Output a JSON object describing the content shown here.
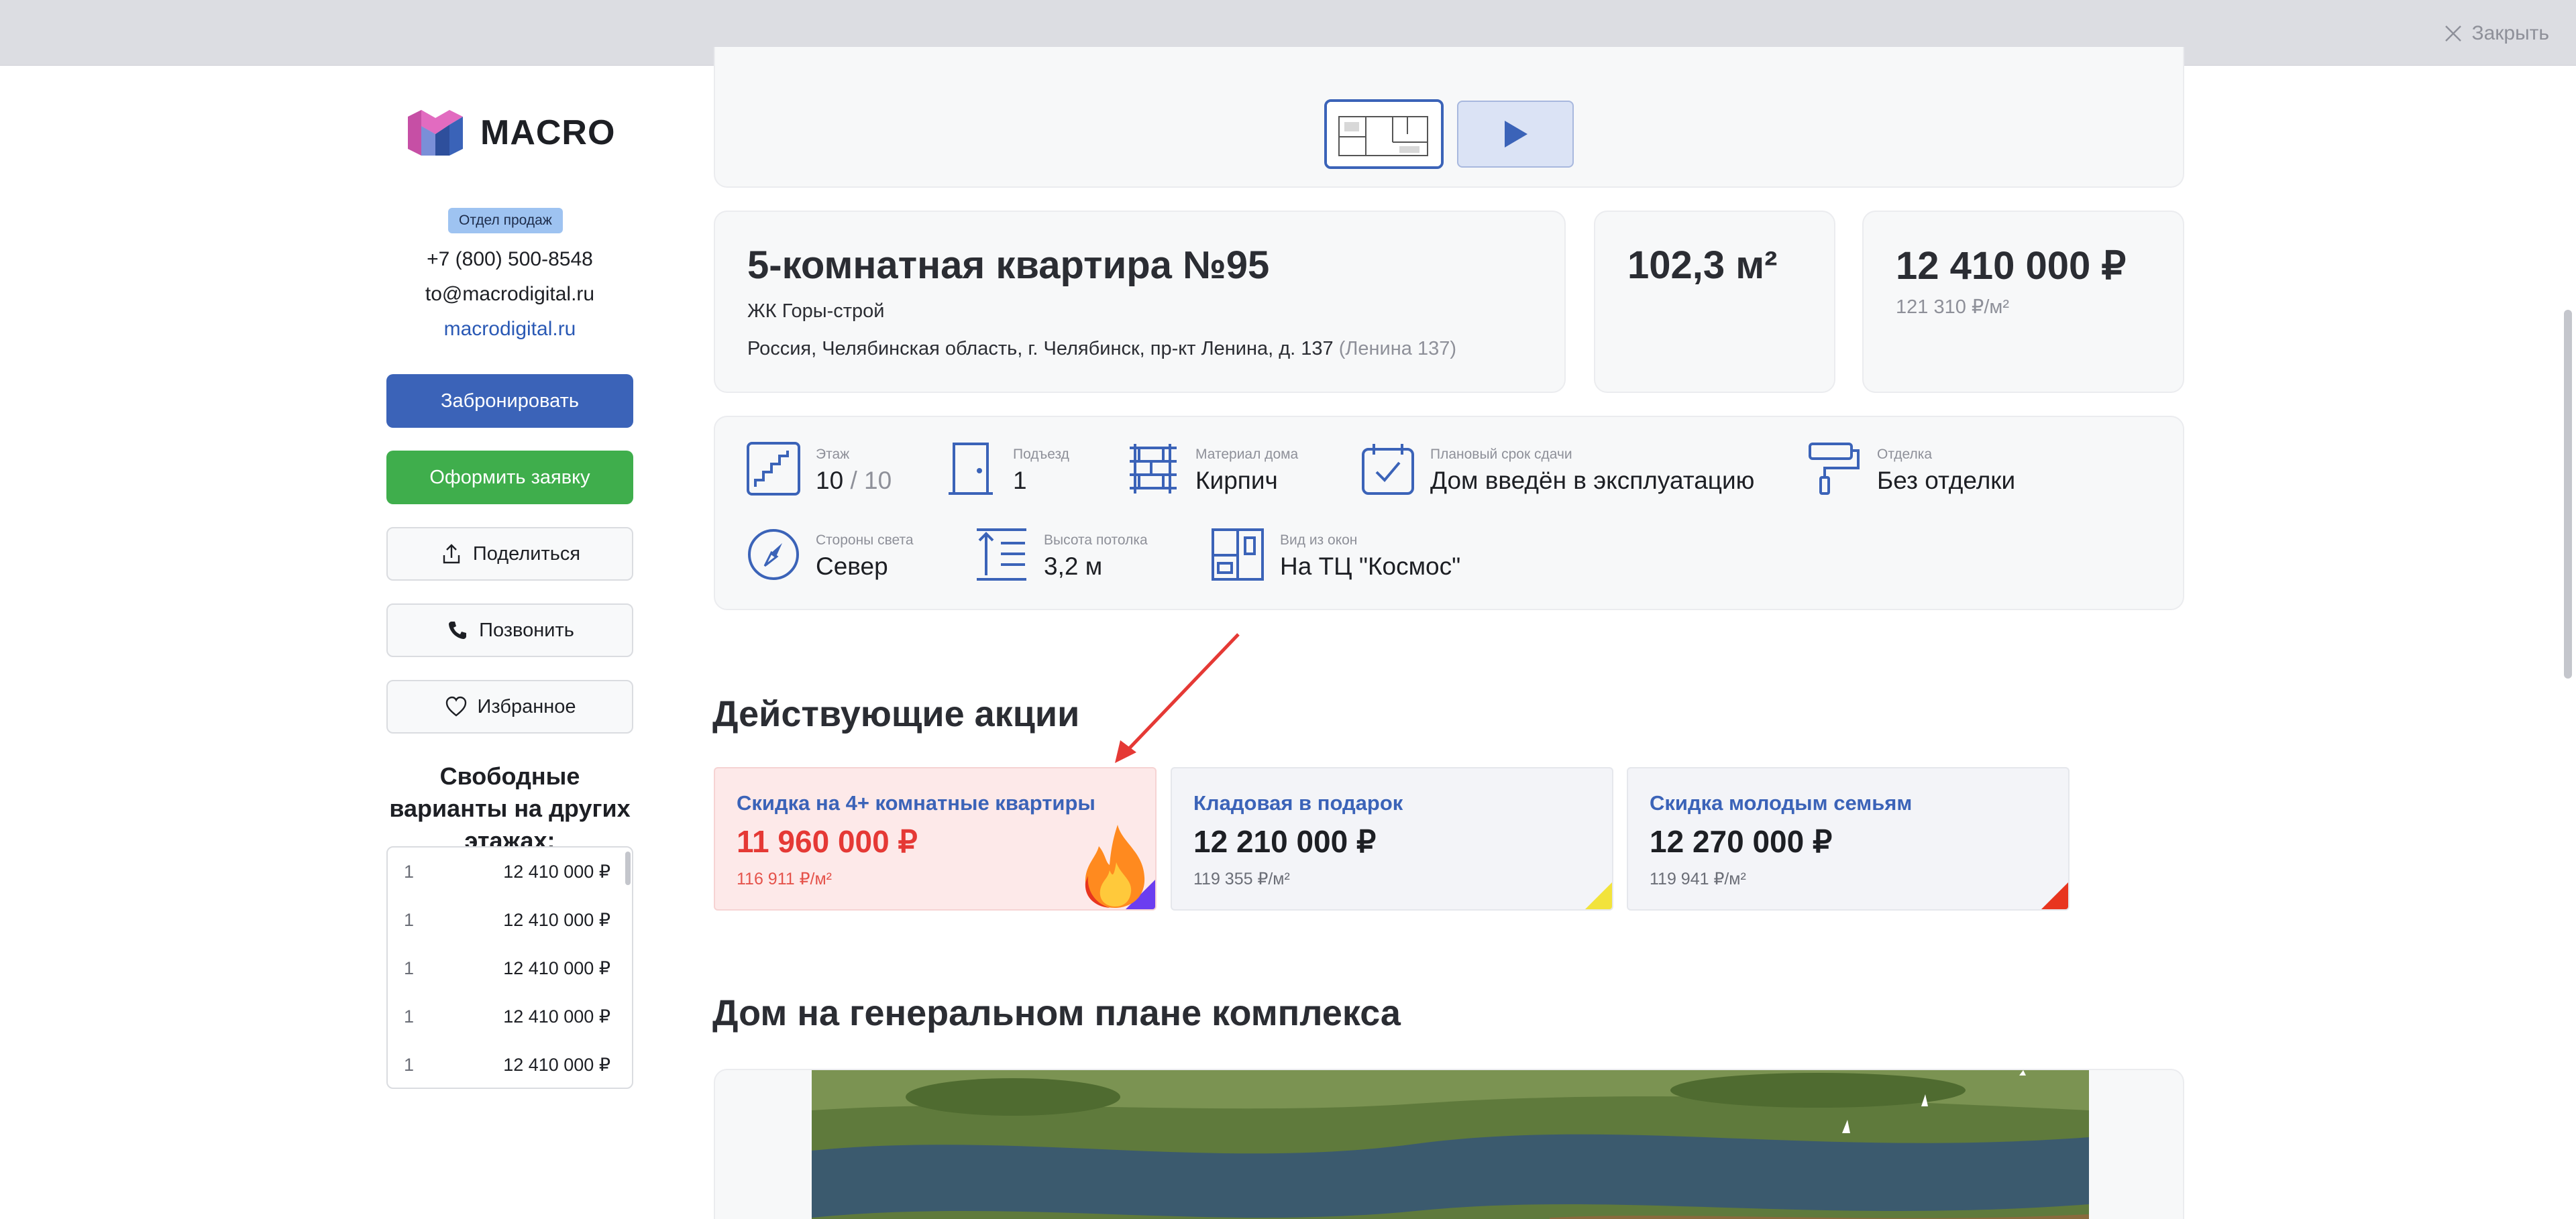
{
  "topbar": {
    "close_label": "Закрыть"
  },
  "sidebar": {
    "logo_text": "MACRO",
    "badge": "Отдел продаж",
    "phone": "+7 (800) 500-8548",
    "email": "to@macrodigital.ru",
    "site": "macrodigital.ru",
    "buttons": {
      "book": "Забронировать",
      "apply": "Оформить заявку",
      "share": "Поделиться",
      "call": "Позвонить",
      "favorite": "Избранное"
    },
    "free_title": "Свободные варианты на других этажах:",
    "free_list": [
      {
        "floor": "1",
        "price": "12 410 000 ₽"
      },
      {
        "floor": "1",
        "price": "12 410 000 ₽"
      },
      {
        "floor": "1",
        "price": "12 410 000 ₽"
      },
      {
        "floor": "1",
        "price": "12 410 000 ₽"
      },
      {
        "floor": "1",
        "price": "12 410 000 ₽"
      }
    ]
  },
  "apartment": {
    "title": "5-комнатная квартира №95",
    "complex": "ЖК Горы-строй",
    "address": "Россия, Челябинская область, г. Челябинск, пр-кт Ленина, д. 137",
    "address_short": "(Ленина 137)",
    "area": "102,3 м²",
    "price": "12 410 000 ₽",
    "price_per_m": "121 310 ₽/м²"
  },
  "features": {
    "floor": {
      "label": "Этаж",
      "value": "10",
      "of": "/ 10"
    },
    "entrance": {
      "label": "Подъезд",
      "value": "1"
    },
    "material": {
      "label": "Материал дома",
      "value": "Кирпич"
    },
    "deadline": {
      "label": "Плановый срок сдачи",
      "value": "Дом введён в эксплуатацию"
    },
    "finish": {
      "label": "Отделка",
      "value": "Без отделки"
    },
    "orientation": {
      "label": "Стороны света",
      "value": "Север"
    },
    "ceiling": {
      "label": "Высота потолка",
      "value": "3,2 м"
    },
    "view": {
      "label": "Вид из окон",
      "value": "На ТЦ \"Космос\""
    }
  },
  "promos_title": "Действующие акции",
  "promos": [
    {
      "title": "Скидка на 4+ комнатные квартиры",
      "price": "11 960 000 ₽",
      "per_m": "116 911 ₽/м²",
      "accent": "#6b3df0"
    },
    {
      "title": "Кладовая в подарок",
      "price": "12 210 000 ₽",
      "per_m": "119 355 ₽/м²",
      "accent": "#f2e33b"
    },
    {
      "title": "Скидка молодым семьям",
      "price": "12 270 000 ₽",
      "per_m": "119 941 ₽/м²",
      "accent": "#e8351f"
    }
  ],
  "plan_title": "Дом на генеральном плане комплекса",
  "colors": {
    "primary": "#3b63b8",
    "success": "#3fae4c",
    "danger": "#e53935",
    "annotation": "#e53935"
  }
}
